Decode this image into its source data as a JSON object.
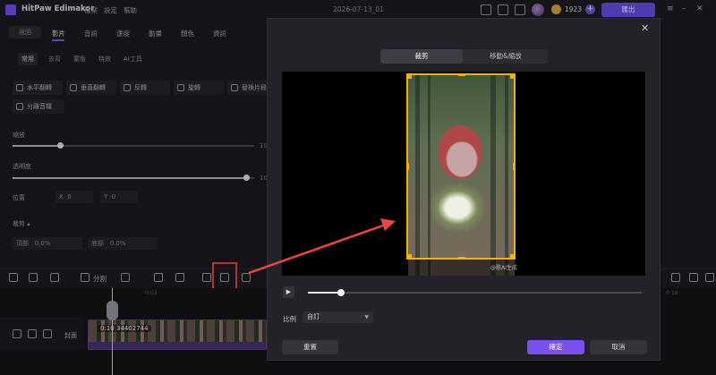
{
  "titlebar": {
    "app_title": "HitPaw Edimakor",
    "menu": [
      "檔案",
      "設定",
      "幫助"
    ],
    "doc_title": "2026-07-13_01",
    "credits": "1923",
    "export_label": "匯出"
  },
  "left_panel": {
    "back_label": "返回",
    "tabs": [
      "影片",
      "音訊",
      "速度",
      "動畫",
      "顏色",
      "資訊"
    ],
    "subtabs": [
      "常用",
      "去背",
      "蒙版",
      "特效",
      "AI工具"
    ],
    "actions": [
      "水平翻轉",
      "垂直翻轉",
      "反轉",
      "旋轉",
      "替換片段"
    ],
    "action_row2": "分離音檔",
    "scale_label": "縮放",
    "scale_value": "10",
    "opacity_label": "透明度",
    "opacity_value": "10",
    "position_label": "位置",
    "pos_x_label": "X",
    "pos_x_value": "0",
    "pos_y_label": "Y",
    "pos_y_value": "0",
    "crop_label": "裁剪",
    "crop_left_label": "頂部",
    "crop_left_value": "0.0%",
    "crop_right_label": "底部",
    "crop_right_value": "0.0%"
  },
  "toolbar": {
    "split_label": "分割"
  },
  "timeline": {
    "track_label": "封面",
    "clip_label": "0:10 34402744",
    "ruler": [
      "0:02",
      "0:18"
    ]
  },
  "crop_dialog": {
    "tabs": [
      "裁剪",
      "移動&縮放"
    ],
    "active_tab": 0,
    "watermark": "@歌AI生成",
    "playback_progress": 0.1,
    "ratio_label": "比例",
    "ratio_value": "自訂",
    "reset_label": "重置",
    "ok_label": "確定",
    "cancel_label": "取消"
  },
  "colors": {
    "accent": "#7a50f0",
    "crop_frame": "#f0b400",
    "highlight": "#ee4444"
  }
}
